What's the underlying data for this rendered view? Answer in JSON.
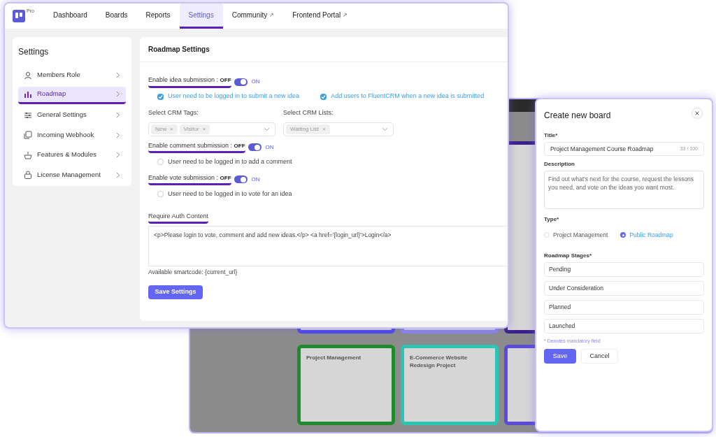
{
  "background_board_window": {
    "cards": [
      {
        "color": "#4f46e5"
      },
      {
        "color": "#8b87e8"
      },
      {
        "color": "#3b1f8a"
      },
      {
        "title": "Project Management",
        "color": "#1f8a2e"
      },
      {
        "title": "E-Commerce Website Redesign Project",
        "color": "#2cc4b2"
      },
      {
        "color": "#5b4bd6"
      }
    ]
  },
  "main_window": {
    "logo_badge": "Pro",
    "nav": [
      {
        "label": "Dashboard",
        "selected": false,
        "external": false
      },
      {
        "label": "Boards",
        "selected": false,
        "external": false
      },
      {
        "label": "Reports",
        "selected": false,
        "external": false
      },
      {
        "label": "Settings",
        "selected": true,
        "external": false
      },
      {
        "label": "Community",
        "selected": false,
        "external": true
      },
      {
        "label": "Frontend Portal",
        "selected": false,
        "external": true
      }
    ],
    "external_mark": "↗",
    "sidebar": {
      "title": "Settings",
      "items": [
        {
          "label": "Members Role",
          "selected": false
        },
        {
          "label": "Roadmap",
          "selected": true
        },
        {
          "label": "General Settings",
          "selected": false
        },
        {
          "label": "Incoming Webhook",
          "selected": false
        },
        {
          "label": "Features & Modules",
          "selected": false
        },
        {
          "label": "License Management",
          "selected": false
        }
      ]
    },
    "settings": {
      "title": "Roadmap Settings",
      "blocks": [
        {
          "kind": "toggle",
          "label": "Enable idea submission :",
          "off_label": "OFF",
          "on_label": "ON",
          "on": true
        },
        {
          "kind": "checkboxes",
          "items": [
            {
              "label": "User need to be logged in to submit a new idea",
              "checked": true
            },
            {
              "label": "Add users to FluentCRM when a new idea is submitted",
              "checked": true
            }
          ]
        },
        {
          "kind": "selects",
          "items": [
            {
              "label": "Select CRM Tags:",
              "tags": [
                "New",
                "Visitor"
              ],
              "remove_mark": "×"
            },
            {
              "label": "Select CRM Lists:",
              "tags": [
                "Waiting List"
              ],
              "remove_mark": "×"
            }
          ]
        },
        {
          "kind": "toggle",
          "label": "Enable comment submission :",
          "off_label": "OFF",
          "on_label": "ON",
          "on": true
        },
        {
          "kind": "checkboxes",
          "items": [
            {
              "label": "User need to be logged in to add a comment",
              "checked": false
            }
          ]
        },
        {
          "kind": "toggle",
          "label": "Enable vote submission :",
          "off_label": "OFF",
          "on_label": "ON",
          "on": true
        },
        {
          "kind": "checkboxes",
          "items": [
            {
              "label": "User need to be logged in to vote for an idea",
              "checked": false
            }
          ]
        },
        {
          "kind": "textarea",
          "label": "Require Auth Content",
          "value": "<p>Please login to vote, comment and add new ideas.</p> <a href='{login_url}'>Login</a>",
          "help": "Available smartcode: {current_url}"
        }
      ],
      "save_button": "Save Settings"
    }
  },
  "modal": {
    "title": "Create new board",
    "title_field": {
      "label": "Title*",
      "value": "Project Management Course Roadmap",
      "counter": "33 / 100"
    },
    "description_field": {
      "label": "Description",
      "value": "Find out what's next for the course, request the lessons you need, and vote on the ideas you want most."
    },
    "type": {
      "label": "Type*",
      "options": [
        {
          "label": "Project Management",
          "selected": false
        },
        {
          "label": "Public Roadmap",
          "selected": true
        }
      ]
    },
    "stages": {
      "label": "Roadmap Stages*",
      "items": [
        "Pending",
        "Under Consideration",
        "Planned",
        "Launched"
      ]
    },
    "note": "* Denotes mandatory field",
    "buttons": [
      {
        "label": "Save",
        "kind": "primary"
      },
      {
        "label": "Cancel",
        "kind": "secondary"
      }
    ]
  }
}
